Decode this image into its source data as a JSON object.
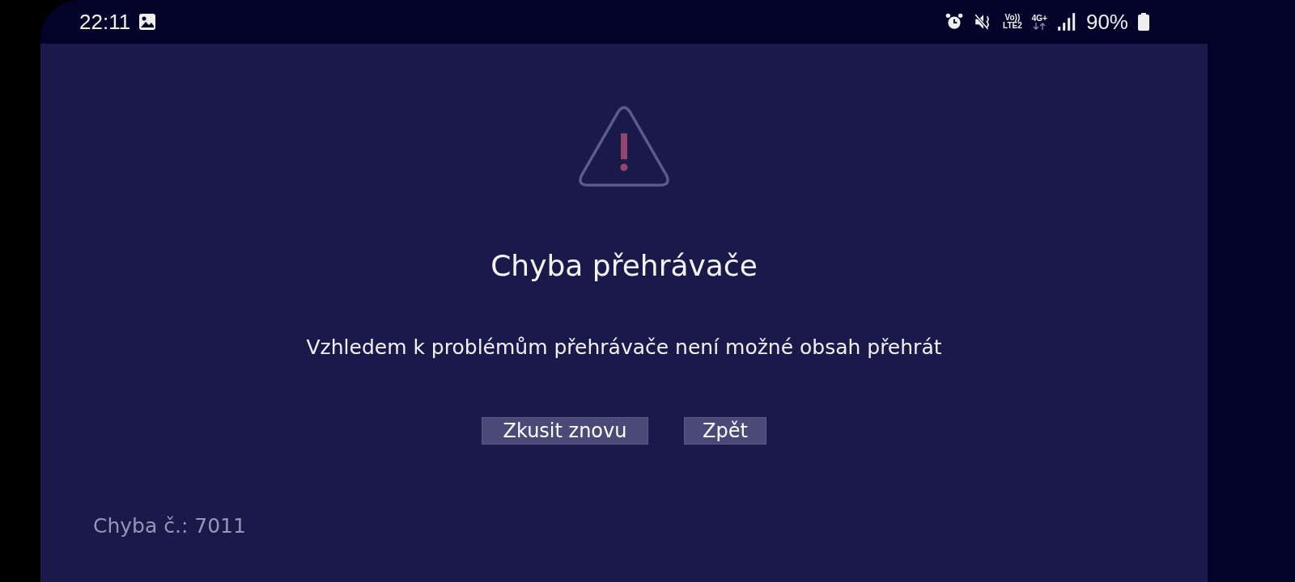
{
  "status_bar": {
    "time": "22:11",
    "volte": "Vo))",
    "lte": "LTE2",
    "network": "4G+",
    "battery": "90%"
  },
  "error": {
    "title": "Chyba přehrávače",
    "message": "Vzhledem k problémům přehrávače není možné obsah přehrát",
    "buttons": [
      {
        "label": "Zkusit znovu"
      },
      {
        "label": "Zpět"
      }
    ],
    "code": "Chyba č.: 7011"
  }
}
